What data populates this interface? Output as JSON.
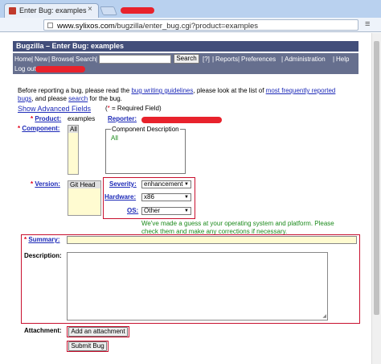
{
  "browser": {
    "tab_title": "Enter Bug: examples",
    "url_prefix": "www.sylixos.com",
    "url_path": "/bugzilla/enter_bug.cgi?product=examples"
  },
  "header": {
    "title": "Bugzilla – Enter Bug: examples"
  },
  "nav": {
    "home": "Home",
    "new": "New",
    "browse": "Browse",
    "search": "Search",
    "search_button": "Search",
    "help_bracket": "[?]",
    "reports": "Reports",
    "preferences": "Preferences",
    "administration": "Administration",
    "help": "Help",
    "logout": "Log out"
  },
  "intro": {
    "line1_a": "Before reporting a bug, please read the ",
    "guidelines_link": "bug writing guidelines",
    "line1_b": ", please look at the list of ",
    "frequent_link": "most frequently reported",
    "line2_a": "bugs",
    "line2_b": ", and please ",
    "search_link": "search",
    "line2_c": " for the bug."
  },
  "advanced_link": "Show Advanced Fields",
  "required_note": {
    "open": "(",
    "star": "*",
    "text": " = Required Field)"
  },
  "fields": {
    "product_label": "Product:",
    "product_value": "examples",
    "reporter_label": "Reporter:",
    "component_label": "Component:",
    "component_option": "All",
    "component_desc_legend": "Component Description",
    "component_desc_value": "All",
    "version_label": "Version:",
    "version_option": "Git Head",
    "severity_label": "Severity:",
    "severity_value": "enhancement",
    "hardware_label": "Hardware:",
    "hardware_value": "x86",
    "os_label": "OS:",
    "os_value": "Other",
    "guess_note_1": "We've made a guess at your operating system and platform. Please",
    "guess_note_2": "check them and make any corrections if necessary.",
    "summary_label": "Summary:",
    "description_label": "Description:",
    "attachment_label": "Attachment:",
    "add_attachment_button": "Add an attachment",
    "submit_button": "Submit Bug"
  },
  "colors": {
    "title_bg": "#424e7a",
    "nav_bg": "#666f8e",
    "link": "#1d2ab8",
    "required": "#e2001a",
    "highlight_box": "#c8102e",
    "note_green": "#1b8a1b",
    "summary_bg": "#fffbd1"
  }
}
